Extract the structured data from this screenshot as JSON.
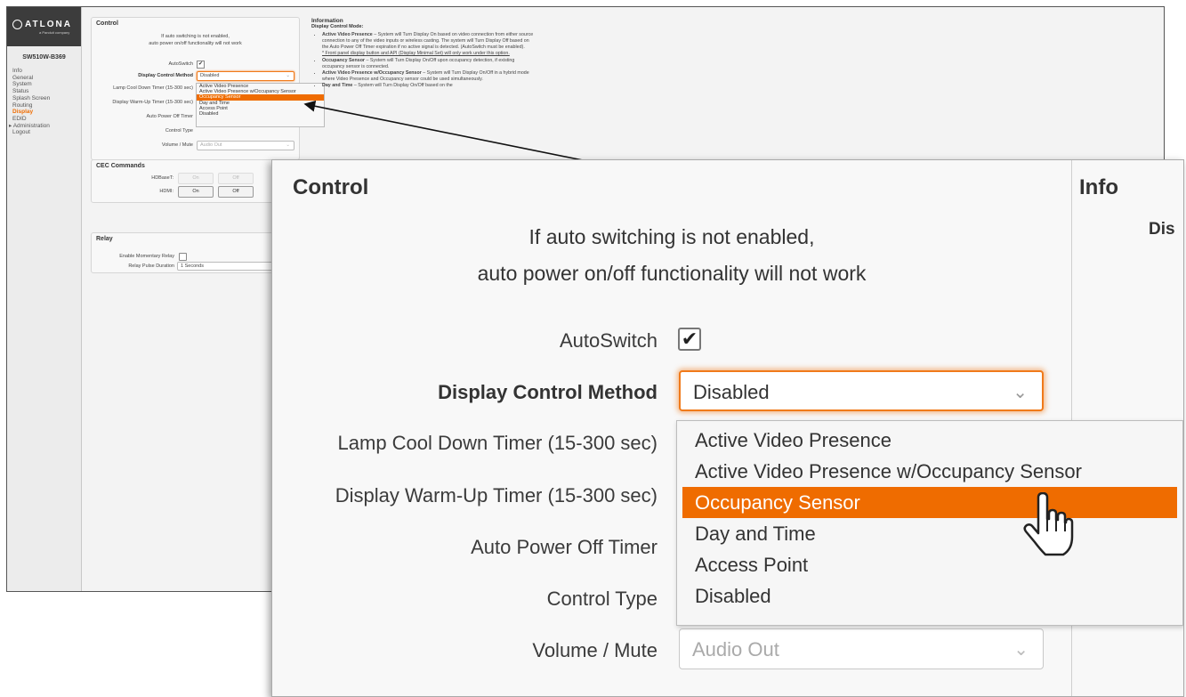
{
  "logo": {
    "brand": "ATLONA",
    "tagline": "a Panduit company"
  },
  "model": "SW510W-B369",
  "nav": [
    {
      "label": "Info",
      "active": false
    },
    {
      "label": "General",
      "active": false
    },
    {
      "label": "System",
      "active": false
    },
    {
      "label": "Status",
      "active": false
    },
    {
      "label": "Splash Screen",
      "active": false
    },
    {
      "label": "Routing",
      "active": false
    },
    {
      "label": "Display",
      "active": true
    },
    {
      "label": "EDID",
      "active": false
    },
    {
      "label": "Administration",
      "active": false
    },
    {
      "label": "Logout",
      "active": false
    }
  ],
  "control": {
    "title": "Control",
    "warning_line1": "If auto switching is not enabled,",
    "warning_line2": "auto power on/off functionality will not work",
    "autoswitch_label": "AutoSwitch",
    "autoswitch_checked": true,
    "method_label": "Display Control Method",
    "method_value": "Disabled",
    "lamp_label": "Lamp Cool Down Timer (15-300 sec)",
    "warmup_label": "Display Warm-Up Timer (15-300 sec)",
    "poweroff_label": "Auto Power Off Timer",
    "control_type_label": "Control Type",
    "volume_label": "Volume / Mute",
    "volume_value": "Audio Out",
    "options": [
      "Active Video Presence",
      "Active Video Presence w/Occupancy Sensor",
      "Occupancy Sensor",
      "Day and Time",
      "Access Point",
      "Disabled"
    ],
    "highlighted_option": "Occupancy Sensor"
  },
  "cec": {
    "title": "CEC Commands",
    "hdbaset_label": "HDBaseT:",
    "hdmi_label": "HDMI:",
    "on_label": "On",
    "off_label": "Off"
  },
  "relay": {
    "title": "Relay",
    "momentary_label": "Enable Momentary Relay",
    "pulse_label": "Relay Pulse Duration",
    "pulse_value": "1 Seconds"
  },
  "information": {
    "title": "Information",
    "subtitle": "Display Control Mode:",
    "items": [
      {
        "term": "Active Video Presence",
        "text": " – System will Turn Display On based on video connection from either source connection to any of the video inputs or wireless casting. The system will Turn Display Off based on the Auto Power Off Timer expiration if no active signal is detected. (AutoSwitch must be enabled)."
      },
      {
        "term": "",
        "text": "* Front panel display button and API (Display Minimal Set) will only work under this option."
      },
      {
        "term": "Occupancy Sensor",
        "text": " – System will Turn Display On/Off upon occupancy detection, if existing occupancy sensor is connected."
      },
      {
        "term": "Active Video Presence w/Occupancy Sensor",
        "text": " – System will Turn Display On/Off in a hybrid mode where Video Presence and Occupancy sensor could be used simultaneously."
      },
      {
        "term": "Day and Time",
        "text": " – System will Turn Display On/Off based on the"
      }
    ],
    "zoom_title_fragment": "Info",
    "zoom_subtitle_fragment": "Dis"
  },
  "colors": {
    "accent": "#ef6c00",
    "sidebar": "#ececec",
    "logo_bg": "#3c3c3c"
  },
  "icons": [
    "atlona-logo-icon",
    "chevron-down-icon",
    "checkmark-icon",
    "hand-cursor-icon",
    "callout-arrow-icon"
  ]
}
